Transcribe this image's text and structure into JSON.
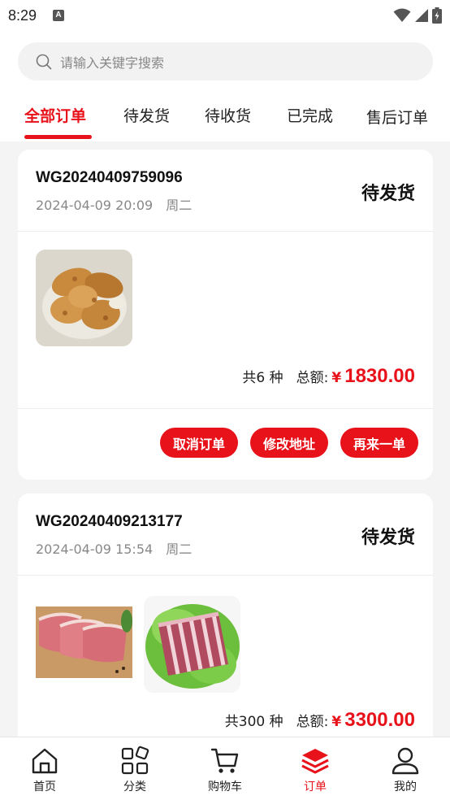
{
  "status_bar": {
    "time": "8:29",
    "a_badge": "A"
  },
  "search": {
    "placeholder": "请输入关键字搜索",
    "icon": "search-icon"
  },
  "tabs": [
    {
      "label": "全部订单",
      "active": true
    },
    {
      "label": "待发货",
      "active": false
    },
    {
      "label": "待收货",
      "active": false
    },
    {
      "label": "已完成",
      "active": false
    },
    {
      "label": "售后订单",
      "active": false
    }
  ],
  "orders": [
    {
      "order_no": "WG20240409759096",
      "time": "2024-04-09 20:09",
      "weekday": "周二",
      "status": "待发货",
      "count_text": "共6 种",
      "total_label": "总额:",
      "currency": "¥",
      "amount": "1830.00",
      "items": [
        "fried-chicken-image"
      ],
      "actions": [
        "取消订单",
        "修改地址",
        "再来一单"
      ]
    },
    {
      "order_no": "WG20240409213177",
      "time": "2024-04-09 15:54",
      "weekday": "周二",
      "status": "待发货",
      "count_text": "共300 种",
      "total_label": "总额:",
      "currency": "¥",
      "amount": "3300.00",
      "items": [
        "pork-steak-image",
        "pork-ribs-image"
      ]
    }
  ],
  "bottom_nav": [
    {
      "label": "首页",
      "icon": "home-icon",
      "active": false
    },
    {
      "label": "分类",
      "icon": "category-icon",
      "active": false
    },
    {
      "label": "购物车",
      "icon": "cart-icon",
      "active": false
    },
    {
      "label": "订单",
      "icon": "orders-icon",
      "active": true
    },
    {
      "label": "我的",
      "icon": "profile-icon",
      "active": false
    }
  ],
  "colors": {
    "accent": "#e8121a",
    "background": "#f4f4f4"
  }
}
